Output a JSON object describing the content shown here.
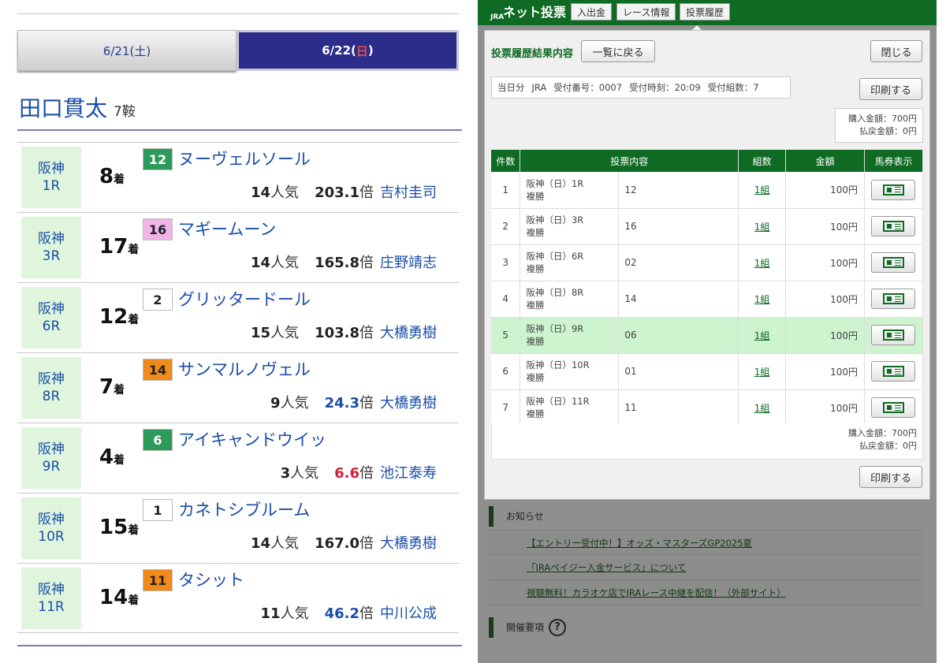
{
  "left": {
    "tabs": [
      {
        "label": "6/21(土)"
      },
      {
        "label_main": "6/22(",
        "label_day": "日",
        "label_close": ")"
      }
    ],
    "jockey": {
      "name": "田口貫太",
      "rides": "7鞍"
    },
    "rows": [
      {
        "venue": "阪神",
        "race": "1R",
        "place": "8",
        "place_suffix": "着",
        "no": "12",
        "name": "ヌーヴェルソール",
        "pop": "14",
        "pop_suffix": "人気",
        "odds": "203.1",
        "odds_suffix": "倍",
        "rider": "吉村圭司",
        "no_bg": "#2e9a5a",
        "no_fg": "#ffffff",
        "odds_style": "plain"
      },
      {
        "venue": "阪神",
        "race": "3R",
        "place": "17",
        "place_suffix": "着",
        "no": "16",
        "name": "マギームーン",
        "pop": "14",
        "pop_suffix": "人気",
        "odds": "165.8",
        "odds_suffix": "倍",
        "rider": "庄野靖志",
        "no_bg": "#f0b4e8",
        "no_fg": "#222222",
        "odds_style": "plain"
      },
      {
        "venue": "阪神",
        "race": "6R",
        "place": "12",
        "place_suffix": "着",
        "no": "2",
        "name": "グリッタードール",
        "pop": "15",
        "pop_suffix": "人気",
        "odds": "103.8",
        "odds_suffix": "倍",
        "rider": "大橋勇樹",
        "no_bg": "#ffffff",
        "no_fg": "#222222",
        "odds_style": "plain"
      },
      {
        "venue": "阪神",
        "race": "8R",
        "place": "7",
        "place_suffix": "着",
        "no": "14",
        "name": "サンマルノヴェル",
        "pop": "9",
        "pop_suffix": "人気",
        "odds": "24.3",
        "odds_suffix": "倍",
        "rider": "大橋勇樹",
        "no_bg": "#f08a1a",
        "no_fg": "#222222",
        "odds_style": "blue"
      },
      {
        "venue": "阪神",
        "race": "9R",
        "place": "4",
        "place_suffix": "着",
        "no": "6",
        "name": "アイキャンドウイッ",
        "pop": "3",
        "pop_suffix": "人気",
        "odds": "6.6",
        "odds_suffix": "倍",
        "rider": "池江泰寿",
        "no_bg": "#2e9a5a",
        "no_fg": "#ffffff",
        "odds_style": "red"
      },
      {
        "venue": "阪神",
        "race": "10R",
        "place": "15",
        "place_suffix": "着",
        "no": "1",
        "name": "カネトシブルーム",
        "pop": "14",
        "pop_suffix": "人気",
        "odds": "167.0",
        "odds_suffix": "倍",
        "rider": "大橋勇樹",
        "no_bg": "#ffffff",
        "no_fg": "#222222",
        "odds_style": "plain"
      },
      {
        "venue": "阪神",
        "race": "11R",
        "place": "14",
        "place_suffix": "着",
        "no": "11",
        "name": "タシット",
        "pop": "11",
        "pop_suffix": "人気",
        "odds": "46.2",
        "odds_suffix": "倍",
        "rider": "中川公成",
        "no_bg": "#f08a1a",
        "no_fg": "#222222",
        "odds_style": "blue"
      }
    ]
  },
  "right": {
    "header": {
      "logo_small": "JRA",
      "title": "ネット投票",
      "nav": [
        "入出金",
        "レース情報",
        "投票履歴"
      ]
    },
    "dialog": {
      "title": "投票履歴結果内容",
      "back_label": "一覧に戻る",
      "close_label": "閉じる",
      "info": [
        "当日分",
        "JRA",
        "受付番号：0007",
        "受付時刻：20:09",
        "受付組数：7"
      ],
      "print_label": "印刷する",
      "purchase": "購入金額：700円",
      "refund": "払戻金額：0円",
      "columns": [
        "件数",
        "投票内容",
        "組数",
        "金額",
        "馬券表示"
      ],
      "bets": [
        {
          "no": "1",
          "race": "阪神（日）1R",
          "type": "複勝",
          "content": "12",
          "kumi": "1組",
          "amount": "100円"
        },
        {
          "no": "2",
          "race": "阪神（日）3R",
          "type": "複勝",
          "content": "16",
          "kumi": "1組",
          "amount": "100円"
        },
        {
          "no": "3",
          "race": "阪神（日）6R",
          "type": "複勝",
          "content": "02",
          "kumi": "1組",
          "amount": "100円"
        },
        {
          "no": "4",
          "race": "阪神（日）8R",
          "type": "複勝",
          "content": "14",
          "kumi": "1組",
          "amount": "100円"
        },
        {
          "no": "5",
          "race": "阪神（日）9R",
          "type": "複勝",
          "content": "06",
          "kumi": "1組",
          "amount": "100円"
        },
        {
          "no": "6",
          "race": "阪神（日）10R",
          "type": "複勝",
          "content": "01",
          "kumi": "1組",
          "amount": "100円"
        },
        {
          "no": "7",
          "race": "阪神（日）11R",
          "type": "複勝",
          "content": "11",
          "kumi": "1組",
          "amount": "100円"
        }
      ],
      "highlight_index": 4
    },
    "notice": {
      "title": "お知らせ",
      "links": [
        "【エントリー受付中！】オッズ・マスターズGP2025夏",
        "「JRAペイジー入金サービス」について",
        "視聴無料！カラオケ店でJRAレース中継を配信！（外部サイト）"
      ]
    },
    "kaisai": {
      "title": "開催要項",
      "help_icon": "?"
    }
  }
}
